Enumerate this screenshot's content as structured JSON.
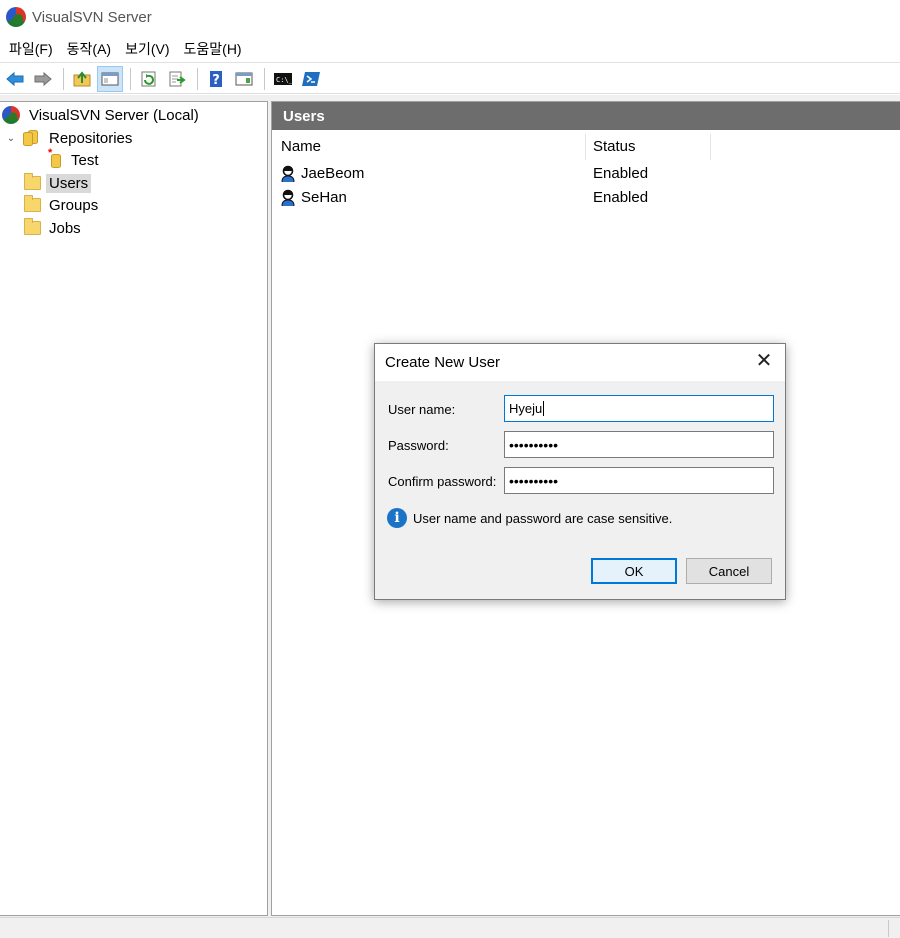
{
  "window": {
    "title": "VisualSVN Server"
  },
  "menu": [
    "파일(F)",
    "동작(A)",
    "보기(V)",
    "도움말(H)"
  ],
  "toolbar": {
    "buttons": [
      "back",
      "forward",
      "up-folder",
      "show-hide-console-tree",
      "refresh",
      "export-list",
      "help",
      "show-action-pane",
      "command-prompt",
      "powershell"
    ]
  },
  "tree": {
    "root": "VisualSVN Server (Local)",
    "repositories": "Repositories",
    "repo_items": [
      "Test"
    ],
    "users": "Users",
    "groups": "Groups",
    "jobs": "Jobs"
  },
  "content": {
    "header": "Users",
    "columns": {
      "name": "Name",
      "status": "Status"
    },
    "rows": [
      {
        "name": "JaeBeom",
        "status": "Enabled"
      },
      {
        "name": "SeHan",
        "status": "Enabled"
      }
    ]
  },
  "dialog": {
    "title": "Create New User",
    "username_label": "User name:",
    "username_value": "Hyeju",
    "password_label": "Password:",
    "password_value": "••••••••••",
    "confirm_label": "Confirm password:",
    "confirm_value": "••••••••••",
    "info": "User name and password are case sensitive.",
    "ok": "OK",
    "cancel": "Cancel"
  },
  "colors": {
    "selection": "#cce4f7",
    "header_bg": "#6d6d6d",
    "accent": "#0078d7"
  }
}
